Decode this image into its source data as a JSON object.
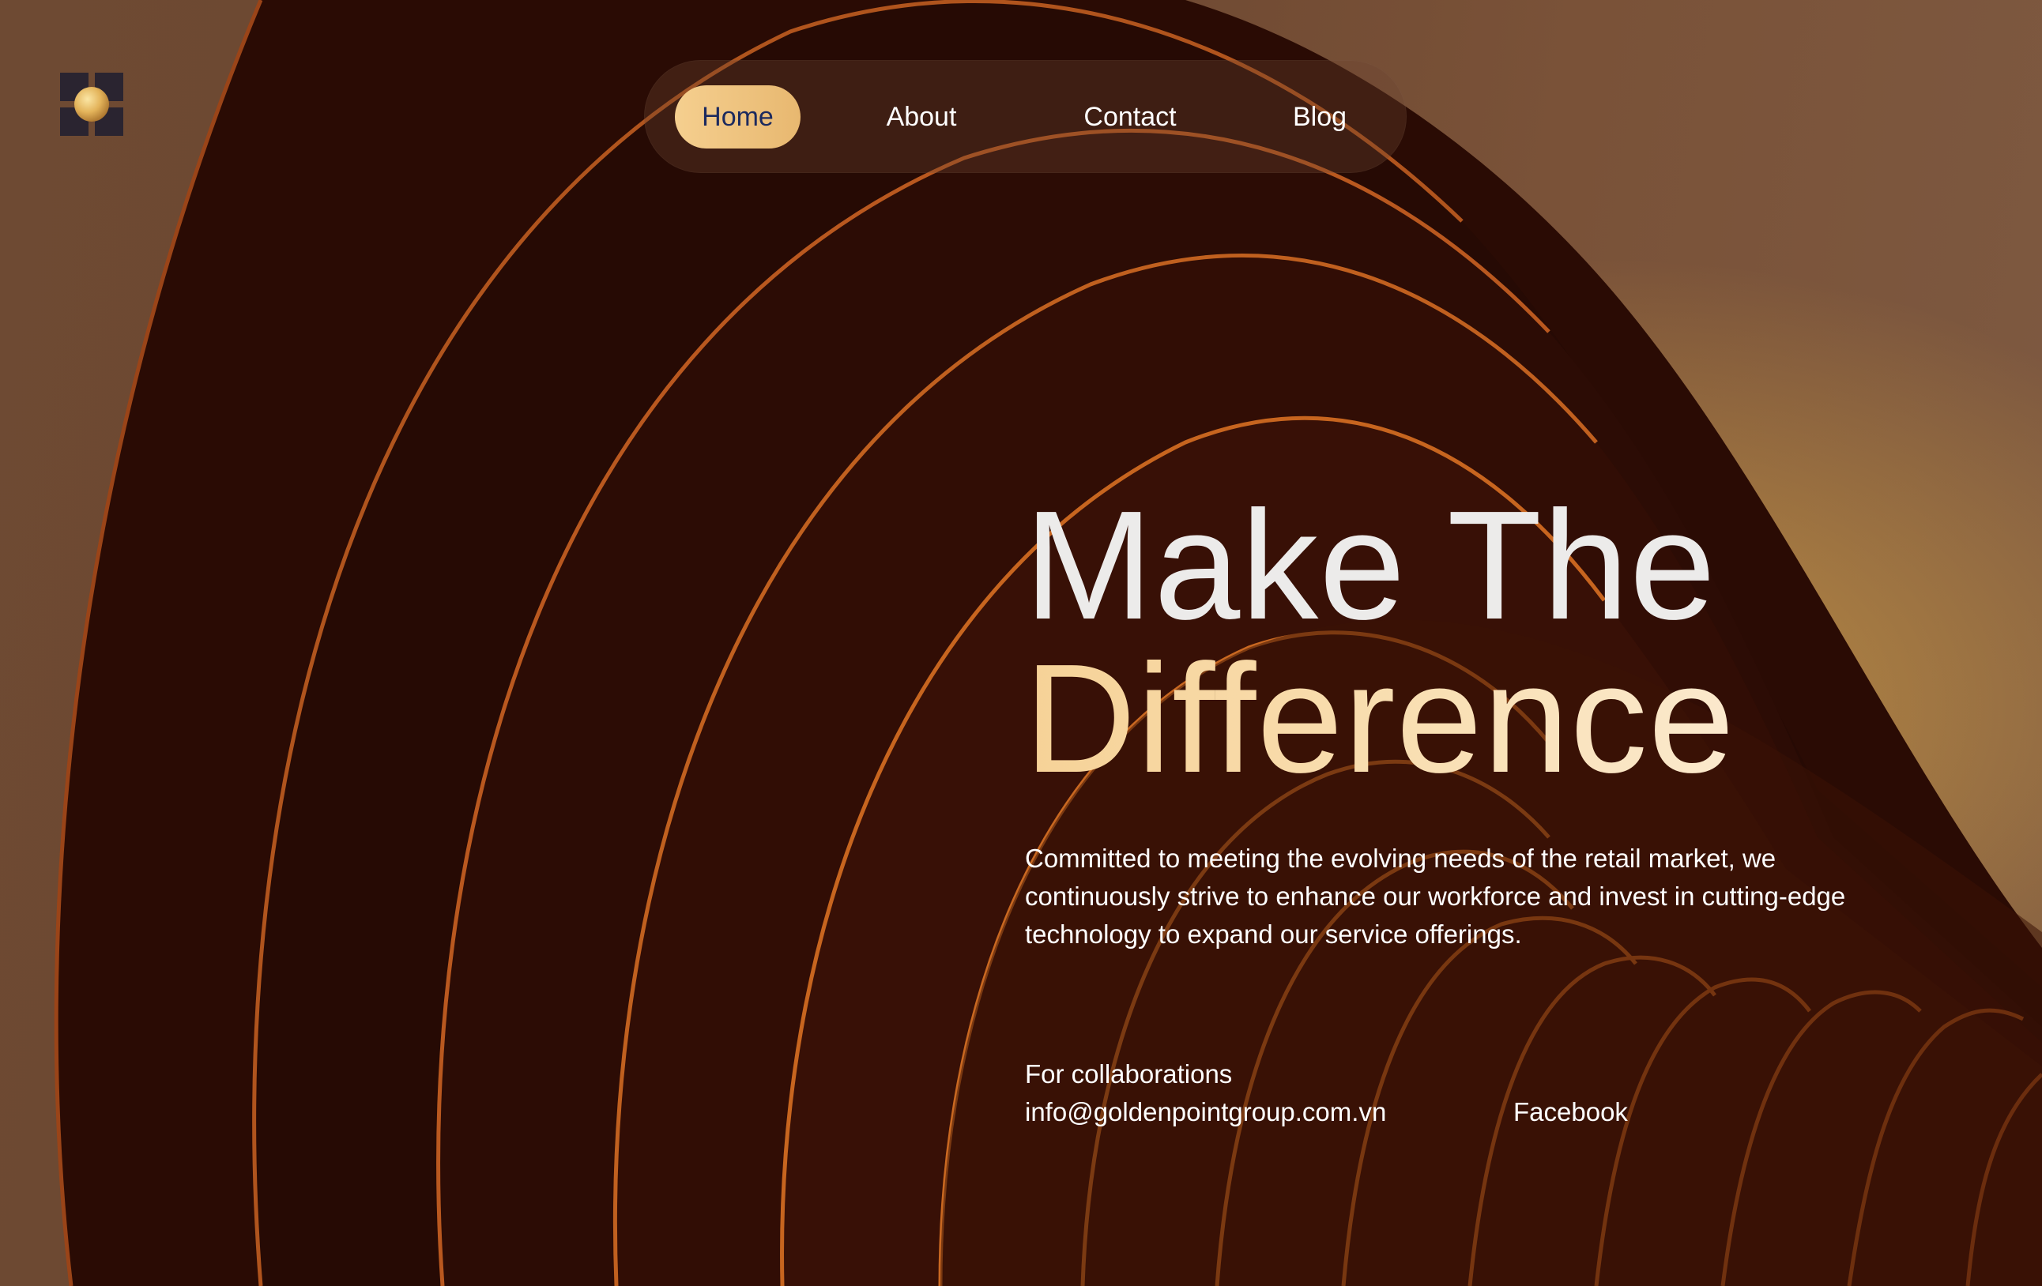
{
  "brand": {
    "logo_icon": "gold-sphere-grid-logo-icon"
  },
  "nav": {
    "items": [
      {
        "label": "Home",
        "active": true
      },
      {
        "label": "About",
        "active": false
      },
      {
        "label": "Contact",
        "active": false
      },
      {
        "label": "Blog",
        "active": false
      }
    ]
  },
  "hero": {
    "title_line1": "Make The",
    "title_line2": "Difference",
    "description_lines": [
      "Committed to meeting the evolving needs of the retail market, we",
      "continuously strive to enhance our workforce and invest in cutting-edge",
      "technology to expand our service offerings."
    ]
  },
  "contact": {
    "label": "For collaborations",
    "email": "info@goldenpointgroup.com.vn",
    "social_link": "Facebook"
  },
  "colors": {
    "background": "#6d4a33",
    "accent_gold": "#f5cf8f",
    "title_white": "#ecebea",
    "title_gold": "#f7d9a2",
    "nav_active_text": "#1c2a5e"
  }
}
